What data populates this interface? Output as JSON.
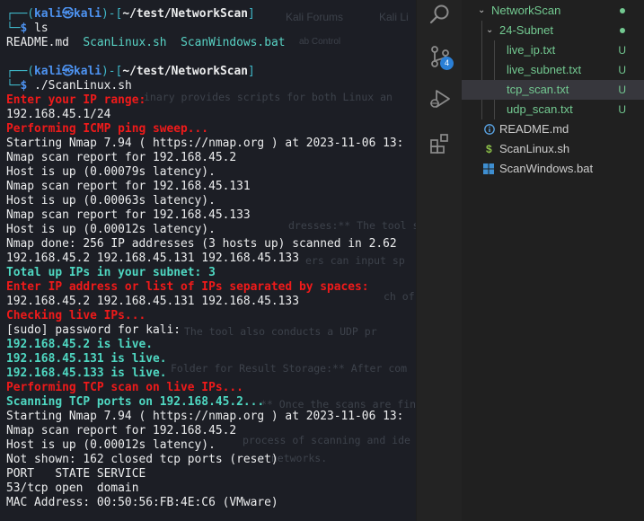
{
  "terminal": {
    "background_color": "#1c1e25",
    "lines": [
      {
        "type": "prompt",
        "user": "kali",
        "host": "kali",
        "path": "~/test/NetworkScan"
      },
      {
        "type": "command",
        "cmd": "ls"
      },
      {
        "type": "ls",
        "items": [
          "README.md",
          "ScanLinux.sh",
          "ScanWindows.bat"
        ]
      },
      {
        "type": "blank"
      },
      {
        "type": "prompt",
        "user": "kali",
        "host": "kali",
        "path": "~/test/NetworkScan"
      },
      {
        "type": "command",
        "cmd": "./ScanLinux.sh"
      },
      {
        "type": "text",
        "style": "red",
        "text": "Enter your IP range:"
      },
      {
        "type": "text",
        "style": "w",
        "text": "192.168.45.1/24"
      },
      {
        "type": "text",
        "style": "red",
        "text": "Performing ICMP ping sweep..."
      },
      {
        "type": "text",
        "style": "w",
        "text": "Starting Nmap 7.94 ( https://nmap.org ) at 2023-11-06 13:"
      },
      {
        "type": "text",
        "style": "w",
        "text": "Nmap scan report for 192.168.45.2"
      },
      {
        "type": "text",
        "style": "w",
        "text": "Host is up (0.00079s latency)."
      },
      {
        "type": "text",
        "style": "w",
        "text": "Nmap scan report for 192.168.45.131"
      },
      {
        "type": "text",
        "style": "w",
        "text": "Host is up (0.00063s latency)."
      },
      {
        "type": "text",
        "style": "w",
        "text": "Nmap scan report for 192.168.45.133"
      },
      {
        "type": "text",
        "style": "w",
        "text": "Host is up (0.00012s latency)."
      },
      {
        "type": "text",
        "style": "w",
        "text": "Nmap done: 256 IP addresses (3 hosts up) scanned in 2.62"
      },
      {
        "type": "text",
        "style": "w",
        "text": "192.168.45.2 192.168.45.131 192.168.45.133"
      },
      {
        "type": "text",
        "style": "cyan",
        "text": "Total up IPs in your subnet: 3"
      },
      {
        "type": "text",
        "style": "red",
        "text": "Enter IP address or list of IPs separated by spaces:"
      },
      {
        "type": "text",
        "style": "w",
        "text": "192.168.45.2 192.168.45.131 192.168.45.133"
      },
      {
        "type": "text",
        "style": "red",
        "text": "Checking live IPs..."
      },
      {
        "type": "text",
        "style": "w",
        "text": "[sudo] password for kali:"
      },
      {
        "type": "text",
        "style": "cyan",
        "text": "192.168.45.2 is live."
      },
      {
        "type": "text",
        "style": "cyan",
        "text": "192.168.45.131 is live."
      },
      {
        "type": "text",
        "style": "cyan",
        "text": "192.168.45.133 is live."
      },
      {
        "type": "text",
        "style": "red",
        "text": "Performing TCP scan on live IPs..."
      },
      {
        "type": "text",
        "style": "cyan",
        "text": "Scanning TCP ports on 192.168.45.2..."
      },
      {
        "type": "text",
        "style": "w",
        "text": "Starting Nmap 7.94 ( https://nmap.org ) at 2023-11-06 13:"
      },
      {
        "type": "text",
        "style": "w",
        "text": "Nmap scan report for 192.168.45.2"
      },
      {
        "type": "text",
        "style": "w",
        "text": "Host is up (0.00012s latency)."
      },
      {
        "type": "text",
        "style": "w",
        "text": "Not shown: 162 closed tcp ports (reset)"
      },
      {
        "type": "text",
        "style": "w",
        "text": "PORT   STATE SERVICE"
      },
      {
        "type": "text",
        "style": "w",
        "text": "53/tcp open  domain"
      },
      {
        "type": "text",
        "style": "w",
        "text": "MAC Address: 00:50:56:FB:4E:C6 (VMware)"
      }
    ]
  },
  "background_window": {
    "tab_text": "Kali Forums",
    "tab_text_2": "Kali Li",
    "secondary_tab": "ab Control",
    "fragments": [
      "inary provides scripts for both Linux an",
      "dresses:** The tool scans",
      "ers can input sp",
      "ch of",
      "The tool also conducts a UDP pr",
      "Folder for Result Storage:** After com",
      "** Once the scans are fin",
      "process of scanning and ide",
      "r networks."
    ]
  },
  "activity_bar": {
    "icons": [
      "search-icon",
      "source-control-icon",
      "run-debug-icon",
      "extensions-icon"
    ],
    "source_control_badge": "4"
  },
  "explorer": {
    "accent_green": "#73c991",
    "folder": {
      "name": "NetworkScan"
    },
    "subfolder": {
      "name": "24-Subnet"
    },
    "subfolder_files": [
      {
        "name": "live_ip.txt",
        "status": "U"
      },
      {
        "name": "live_subnet.txt",
        "status": "U"
      },
      {
        "name": "tcp_scan.txt",
        "status": "U",
        "selected": true
      },
      {
        "name": "udp_scan.txt",
        "status": "U"
      }
    ],
    "root_files": [
      {
        "name": "README.md",
        "icon": "info-icon"
      },
      {
        "name": "ScanLinux.sh",
        "icon": "dollar-icon"
      },
      {
        "name": "ScanWindows.bat",
        "icon": "windows-icon"
      }
    ]
  }
}
